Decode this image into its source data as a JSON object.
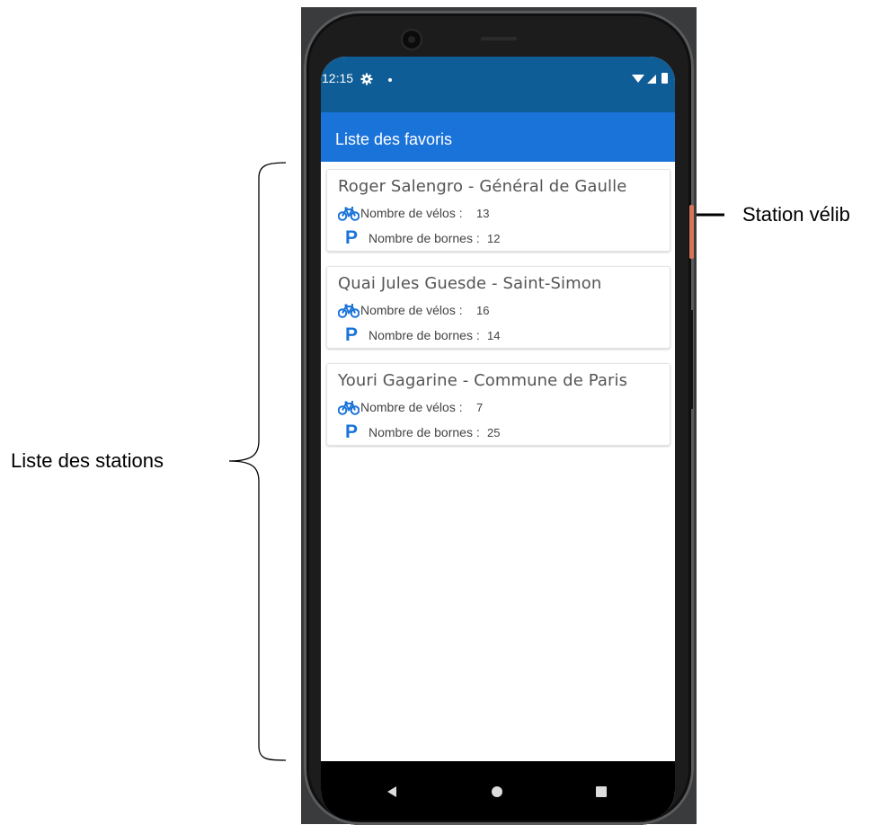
{
  "annotations": {
    "list_label": "Liste des stations",
    "station_label": "Station vélib"
  },
  "status_bar": {
    "time": "12:15",
    "icons": [
      "gear-icon",
      "notification-dot",
      "wifi-icon",
      "signal-icon",
      "battery-icon"
    ]
  },
  "app_bar": {
    "title": "Liste des favoris"
  },
  "stations": [
    {
      "name": "Roger Salengro - Général de Gaulle",
      "bikes_label": "Nombre de vélos :",
      "bikes": "13",
      "docks_label": "Nombre de bornes :",
      "docks": "12"
    },
    {
      "name": "Quai Jules Guesde - Saint-Simon",
      "bikes_label": "Nombre de vélos :",
      "bikes": "16",
      "docks_label": "Nombre de bornes :",
      "docks": "14"
    },
    {
      "name": "Youri Gagarine - Commune de Paris",
      "bikes_label": "Nombre de vélos :",
      "bikes": "7",
      "docks_label": "Nombre de bornes :",
      "docks": "25"
    }
  ],
  "nav_bar": {
    "icons": [
      "back-icon",
      "home-icon",
      "recents-icon"
    ]
  },
  "colors": {
    "status_bar": "#0f5d96",
    "app_bar": "#1a73d9",
    "accent_icon": "#1a73d9"
  }
}
